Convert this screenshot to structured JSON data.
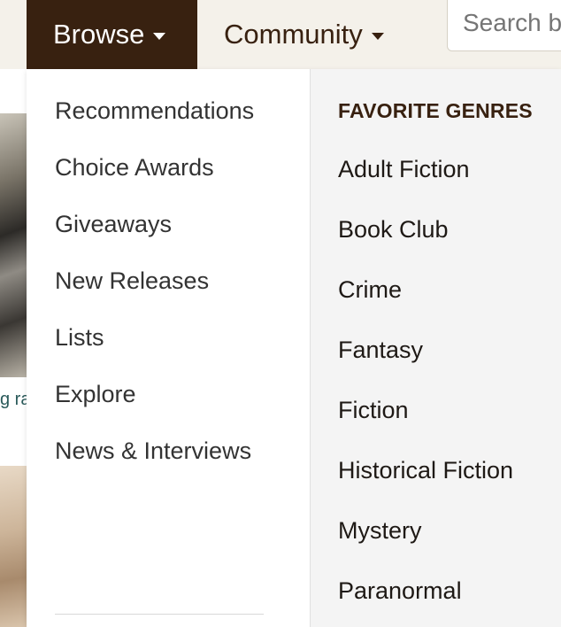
{
  "nav": {
    "browse_label": "Browse",
    "community_label": "Community",
    "search_placeholder": "Search books"
  },
  "background": {
    "caption_fragment": "g ra"
  },
  "browse_menu": {
    "items": [
      {
        "label": "Recommendations"
      },
      {
        "label": "Choice Awards"
      },
      {
        "label": "Giveaways"
      },
      {
        "label": "New Releases"
      },
      {
        "label": "Lists"
      },
      {
        "label": "Explore"
      },
      {
        "label": "News & Interviews"
      }
    ]
  },
  "genres": {
    "heading": "FAVORITE GENRES",
    "items": [
      {
        "label": "Adult Fiction"
      },
      {
        "label": "Book Club"
      },
      {
        "label": "Crime"
      },
      {
        "label": "Fantasy"
      },
      {
        "label": "Fiction"
      },
      {
        "label": "Historical Fiction"
      },
      {
        "label": "Mystery"
      },
      {
        "label": "Paranormal"
      }
    ]
  },
  "colors": {
    "brand_dark": "#382110",
    "bar_background": "#f4f1ea",
    "panel_background": "#f4f4f4"
  }
}
